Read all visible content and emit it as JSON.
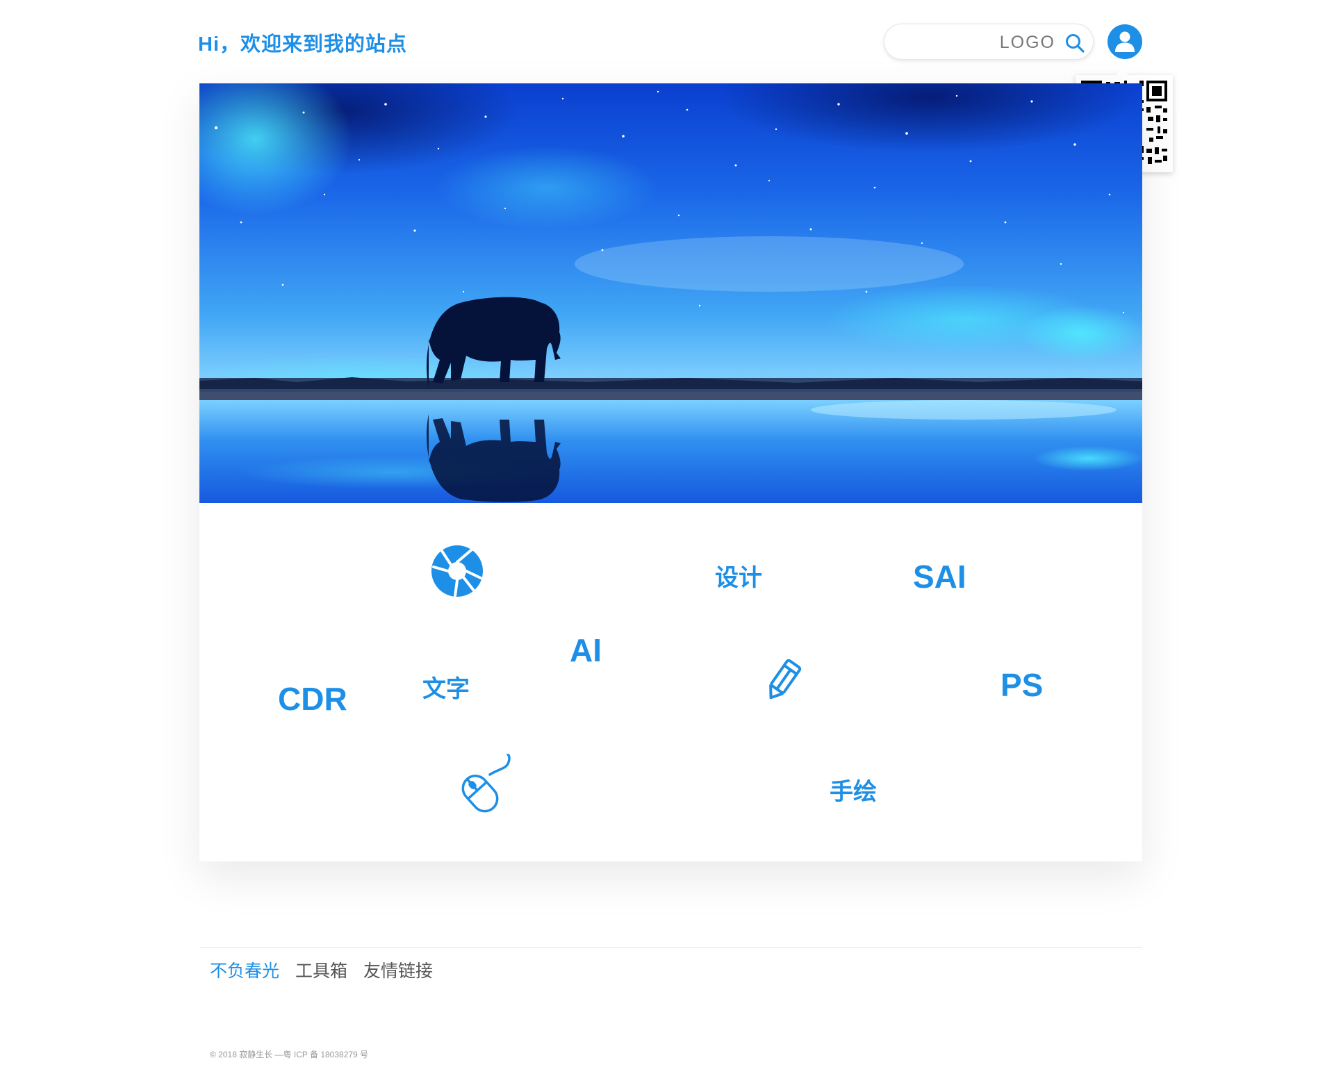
{
  "header": {
    "greeting": "Hi，欢迎来到我的站点",
    "search_placeholder": "LOGO",
    "search_icon": "search-icon",
    "avatar_icon": "user-icon"
  },
  "qr_popup": {
    "icon": "qr-code"
  },
  "hero": {
    "description": "elephant-silhouette-starry-sky-reflection"
  },
  "tags": [
    {
      "label": "设计"
    },
    {
      "label": "SAI"
    },
    {
      "label": "AI"
    },
    {
      "label": "文字"
    },
    {
      "label": "CDR"
    },
    {
      "label": "PS"
    },
    {
      "label": "手绘"
    }
  ],
  "tag_icons": [
    "aperture-icon",
    "pencil-icon",
    "mouse-icon"
  ],
  "footer": {
    "nav": [
      "不负春光",
      "工具箱",
      "友情链接"
    ],
    "active_index": 0,
    "copyright": "© 2018 寂静生长 —粤 ICP 备 18038279 号"
  },
  "colors": {
    "accent": "#1e8fe6"
  }
}
